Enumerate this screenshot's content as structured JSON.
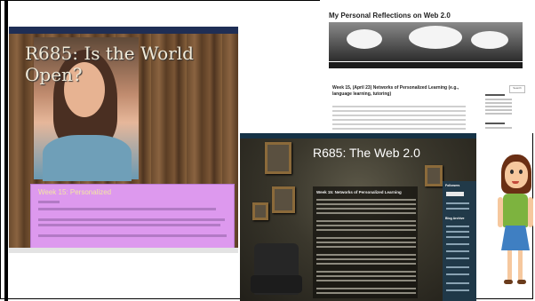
{
  "collage": {
    "blog_wood": {
      "title": "R685: Is the World Open?",
      "post_title": "Week 15: Personalized"
    },
    "blog_white": {
      "title": "My Personal Reflections on Web 2.0",
      "post_title": "Week 15, (April 23) Networks of Personalized Learning (e.g., language learning, tutoring)",
      "search_button": "Search"
    },
    "blog_dark": {
      "title": "R685: The Web 2.0",
      "post_title": "Week 15: Networks of Personalized Learning",
      "sidebar_heading_1": "Followers",
      "sidebar_heading_2": "Blog Archive"
    }
  }
}
